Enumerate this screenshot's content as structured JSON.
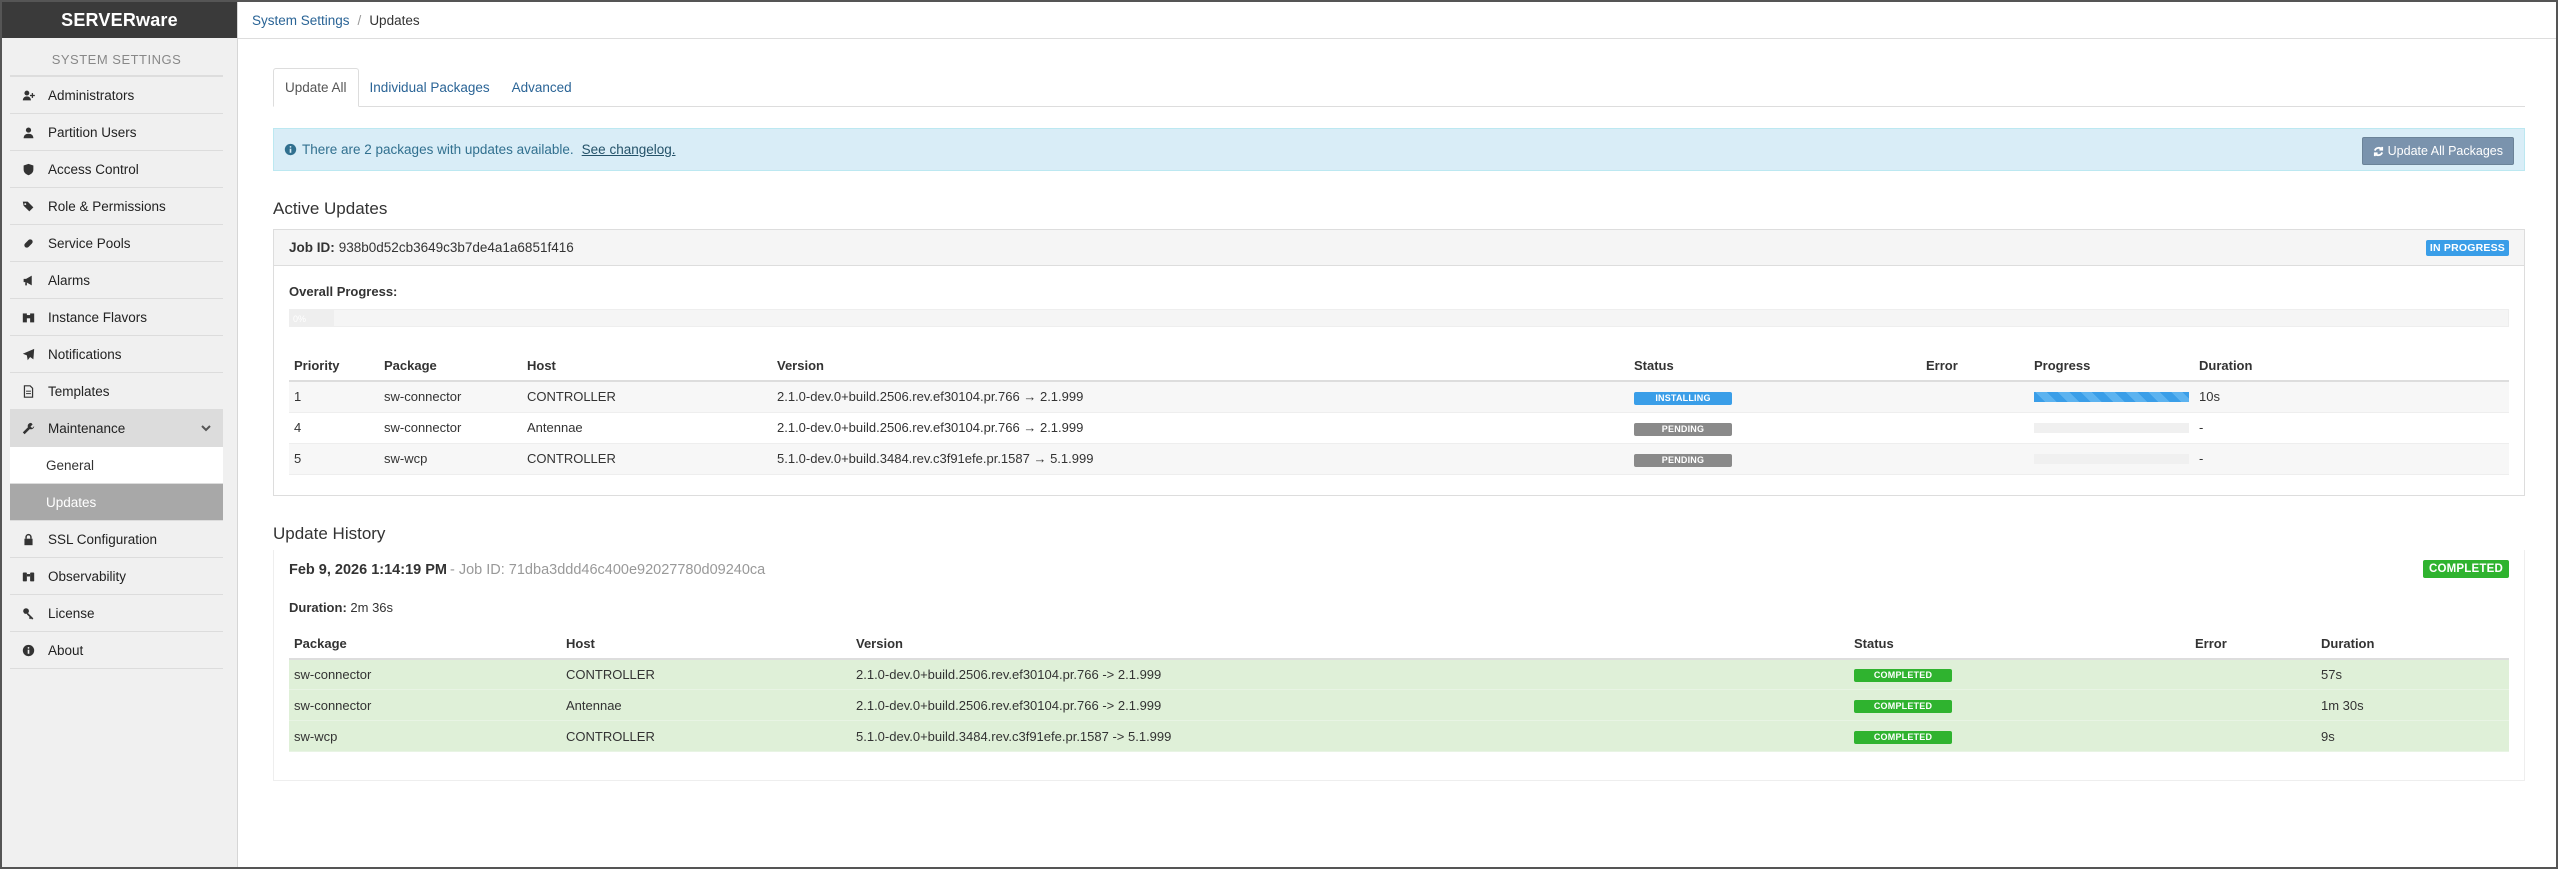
{
  "app": {
    "brand": "SERVERware"
  },
  "sidebar": {
    "section_title": "SYSTEM SETTINGS",
    "items": [
      {
        "label": "Administrators",
        "icon": "user-plus-icon"
      },
      {
        "label": "Partition Users",
        "icon": "user-icon"
      },
      {
        "label": "Access Control",
        "icon": "shield-icon"
      },
      {
        "label": "Role & Permissions",
        "icon": "tags-icon"
      },
      {
        "label": "Service Pools",
        "icon": "pill-icon"
      },
      {
        "label": "Alarms",
        "icon": "bullhorn-icon"
      },
      {
        "label": "Instance Flavors",
        "icon": "cubes-icon"
      },
      {
        "label": "Notifications",
        "icon": "paper-plane-icon"
      },
      {
        "label": "Templates",
        "icon": "file-icon"
      },
      {
        "label": "Maintenance",
        "icon": "wrench-icon"
      },
      {
        "label": "SSL Configuration",
        "icon": "lock-icon"
      },
      {
        "label": "Observability",
        "icon": "binoculars-icon"
      },
      {
        "label": "License",
        "icon": "key-icon"
      },
      {
        "label": "About",
        "icon": "info-circle-icon"
      }
    ],
    "maintenance_sub": [
      {
        "label": "General"
      },
      {
        "label": "Updates"
      }
    ]
  },
  "breadcrumb": {
    "parent": "System Settings",
    "separator": "/",
    "current": "Updates"
  },
  "tabs": [
    {
      "label": "Update All"
    },
    {
      "label": "Individual Packages"
    },
    {
      "label": "Advanced"
    }
  ],
  "alert": {
    "text": "There are 2 packages with updates available.",
    "link": "See changelog.",
    "button": "Update All Packages"
  },
  "active": {
    "heading": "Active Updates",
    "job_label": "Job ID:",
    "job_id": "938b0d52cb3649c3b7de4a1a6851f416",
    "status": "IN PROGRESS",
    "overall_label": "Overall Progress:",
    "overall_text": "0%",
    "overall_progress": 0.02,
    "columns": [
      "Priority",
      "Package",
      "Host",
      "Version",
      "Status",
      "Error",
      "Progress",
      "Duration"
    ],
    "rows": [
      {
        "priority": "1",
        "package": "sw-connector",
        "host": "CONTROLLER",
        "version": "2.1.0-dev.0+build.2506.rev.ef30104.pr.766 → 2.1.999",
        "status": "INSTALLING",
        "error": "",
        "progress": 1.0,
        "duration": "10s"
      },
      {
        "priority": "4",
        "package": "sw-connector",
        "host": "Antennae",
        "version": "2.1.0-dev.0+build.2506.rev.ef30104.pr.766 → 2.1.999",
        "status": "PENDING",
        "error": "",
        "progress": 0,
        "duration": "-"
      },
      {
        "priority": "5",
        "package": "sw-wcp",
        "host": "CONTROLLER",
        "version": "5.1.0-dev.0+build.3484.rev.c3f91efe.pr.1587 → 5.1.999",
        "status": "PENDING",
        "error": "",
        "progress": 0,
        "duration": "-"
      }
    ]
  },
  "history": {
    "heading": "Update History",
    "date": "Feb 9, 2026 1:14:19 PM",
    "job_text": "- Job ID: 71dba3ddd46c400e92027780d09240ca",
    "status": "COMPLETED",
    "duration_label": "Duration:",
    "duration": "2m 36s",
    "columns": [
      "Package",
      "Host",
      "Version",
      "Status",
      "Error",
      "Duration"
    ],
    "rows": [
      {
        "package": "sw-connector",
        "host": "CONTROLLER",
        "version": "2.1.0-dev.0+build.2506.rev.ef30104.pr.766 -> 2.1.999",
        "status": "COMPLETED",
        "error": "",
        "duration": "57s"
      },
      {
        "package": "sw-connector",
        "host": "Antennae",
        "version": "2.1.0-dev.0+build.2506.rev.ef30104.pr.766 -> 2.1.999",
        "status": "COMPLETED",
        "error": "",
        "duration": "1m 30s"
      },
      {
        "package": "sw-wcp",
        "host": "CONTROLLER",
        "version": "5.1.0-dev.0+build.3484.rev.c3f91efe.pr.1587 -> 5.1.999",
        "status": "COMPLETED",
        "error": "",
        "duration": "9s"
      }
    ]
  }
}
